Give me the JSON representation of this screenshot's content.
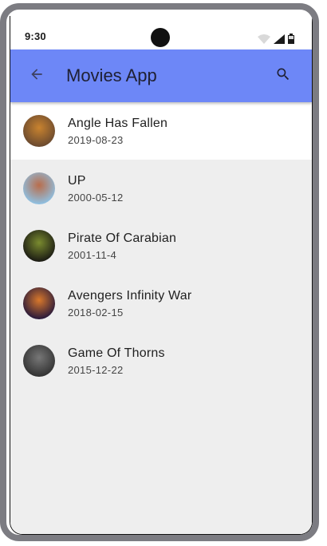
{
  "status_bar": {
    "time": "9:30",
    "icons": [
      "wifi-icon",
      "cellular-signal-icon",
      "battery-icon"
    ]
  },
  "app_bar": {
    "title": "Movies App",
    "color": "#6d87f7",
    "back_icon": "arrow-back-icon",
    "search_icon": "search-icon"
  },
  "movies": [
    {
      "title": "Angle Has Fallen",
      "date": "2019-08-23",
      "selected": true,
      "thumb_colors": [
        "#6b4a2f",
        "#c9832f"
      ]
    },
    {
      "title": "UP",
      "date": "2000-05-12",
      "selected": false,
      "thumb_colors": [
        "#8fbfe0",
        "#b96d4b"
      ]
    },
    {
      "title": "Pirate Of Carabian",
      "date": "2001-11-4",
      "selected": false,
      "thumb_colors": [
        "#1c1c14",
        "#7a8b2f"
      ]
    },
    {
      "title": "Avengers Infinity War",
      "date": "2018-02-15",
      "selected": false,
      "thumb_colors": [
        "#2a1a3a",
        "#d9782b"
      ]
    },
    {
      "title": "Game Of Thorns",
      "date": "2015-12-22",
      "selected": false,
      "thumb_colors": [
        "#333333",
        "#777777"
      ]
    }
  ],
  "colors": {
    "list_background": "#eeeeee",
    "selected_row": "#ffffff"
  }
}
